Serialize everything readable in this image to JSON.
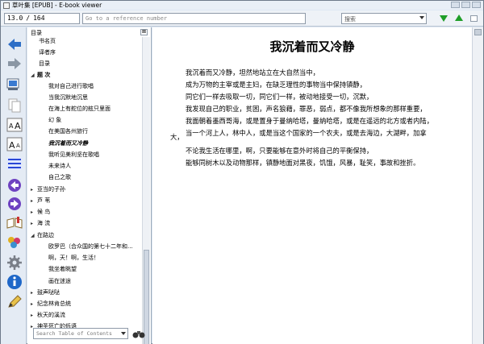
{
  "window": {
    "title": "草叶集 [EPUB] - E-book viewer"
  },
  "toolbar": {
    "page_current": "13.0",
    "page_sep": "/",
    "page_total": "164",
    "reference_placeholder": "Go to a reference number",
    "search_value": "搜索"
  },
  "icons": {
    "back": "back-arrow-icon",
    "forward": "forward-arrow-icon",
    "preferences": "preferences-icon",
    "copy": "copy-icon",
    "font_larger": "font-larger-icon",
    "font_smaller": "font-smaller-icon",
    "toc": "table-of-contents-icon",
    "prev_page": "previous-page-icon",
    "next_page": "next-page-icon",
    "bookmarks": "bookmarks-icon",
    "theme": "theme-icon",
    "settings": "settings-icon",
    "info": "info-icon",
    "edit": "edit-icon",
    "find_next": "find-next-icon",
    "find_prev": "find-previous-icon",
    "accent": "#1f9e28"
  },
  "toc": {
    "header": "目录",
    "search_placeholder": "Search Table of Contents",
    "items": [
      {
        "label": "书名页",
        "level": 1,
        "arrow": ""
      },
      {
        "label": "译者序",
        "level": 1,
        "arrow": ""
      },
      {
        "label": "目录",
        "level": 1,
        "arrow": ""
      },
      {
        "label": "题  次",
        "level": 0,
        "arrow": "◢",
        "bold": true
      },
      {
        "label": "我对自己进行歌唱",
        "level": 2,
        "arrow": ""
      },
      {
        "label": "当我沉默地沉思",
        "level": 2,
        "arrow": ""
      },
      {
        "label": "在海上有舵位的舷只里面",
        "level": 2,
        "arrow": ""
      },
      {
        "label": "幻  象",
        "level": 2,
        "arrow": ""
      },
      {
        "label": "在美国各州旅行",
        "level": 2,
        "arrow": ""
      },
      {
        "label": "我沉着而又冷静",
        "level": 2,
        "arrow": "",
        "selected": true
      },
      {
        "label": "我听见美利坚在歌唱",
        "level": 2,
        "arrow": ""
      },
      {
        "label": "未来诗人",
        "level": 2,
        "arrow": ""
      },
      {
        "label": "自己之歌",
        "level": 2,
        "arrow": ""
      },
      {
        "label": "亚当的子孙",
        "level": 0,
        "arrow": "▸"
      },
      {
        "label": "芦  苇",
        "level": 0,
        "arrow": "▸"
      },
      {
        "label": "候  鸟",
        "level": 0,
        "arrow": "▸"
      },
      {
        "label": "海  流",
        "level": 0,
        "arrow": "▸"
      },
      {
        "label": "在路边",
        "level": 0,
        "arrow": "◢"
      },
      {
        "label": "欧罗巴（合众国的第七十二年和...",
        "level": 2,
        "arrow": ""
      },
      {
        "label": "啊，天！啊，生活！",
        "level": 2,
        "arrow": ""
      },
      {
        "label": "我坐着眺望",
        "level": 2,
        "arrow": ""
      },
      {
        "label": "画在迷途",
        "level": 2,
        "arrow": ""
      },
      {
        "label": "鼓声哒哒",
        "level": 0,
        "arrow": "▸"
      },
      {
        "label": "纪念林肯总统",
        "level": 0,
        "arrow": "▸"
      },
      {
        "label": "秋天的溪流",
        "level": 0,
        "arrow": "▸"
      },
      {
        "label": "神圣死亡的低语",
        "level": 0,
        "arrow": "▸"
      }
    ]
  },
  "content": {
    "title": "我沉着而又冷静",
    "lines": [
      "我沉着而又冷静，坦然地站立在大自然当中，",
      "成为万物的主宰或是主妇，在缺乏理性的事物当中保持镇静，",
      "同它们一样去吸取一切，同它们一样，被动地接受一切，沉默，",
      "我发现自己的职业，贫困，声名狼藉，罪恶，弱点，都不像我所想象的那样重要，",
      "我面朝着墨西哥海，或是置身于曼纳哈塔，曼纳哈塔，或是在遥远的北方或者内陆，",
      "当一个河上人，林中人，或是当这个国家的一个农夫，或是去海边，大湖畔，加拿",
      "大，",
      "不论我生活在哪里，啊，只要能够在意外时将自己的平衡保持，",
      "能够同树木以及动物那样，镇静地面对黑夜，饥饿，风暴，耻笑，事故和挫折。"
    ]
  }
}
